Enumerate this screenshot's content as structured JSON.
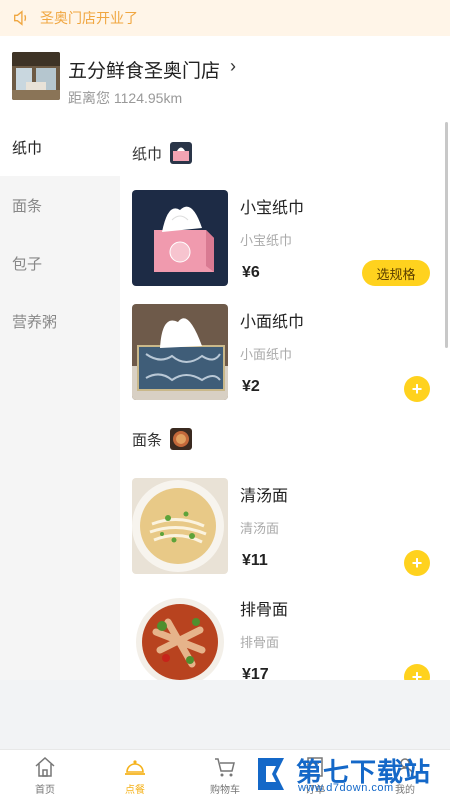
{
  "notice": {
    "text": "圣奥门店开业了",
    "icon": "speaker-icon"
  },
  "store": {
    "name": "五分鲜食圣奥门店",
    "distance": "距离您 1124.95km"
  },
  "categories": [
    "纸巾",
    "面条",
    "包子",
    "营养粥"
  ],
  "active_category": "纸巾",
  "sections": [
    {
      "title": "纸巾",
      "items": [
        {
          "name": "小宝纸巾",
          "desc": "小宝纸巾",
          "price": "¥6",
          "action": "选规格"
        },
        {
          "name": "小面纸巾",
          "desc": "小面纸巾",
          "price": "¥2",
          "action": "+"
        }
      ]
    },
    {
      "title": "面条",
      "items": [
        {
          "name": "清汤面",
          "desc": "清汤面",
          "price": "¥11",
          "action": "+"
        },
        {
          "name": "排骨面",
          "desc": "排骨面",
          "price": "¥17",
          "action": "+"
        }
      ]
    }
  ],
  "tabs": [
    {
      "label": "首页",
      "icon": "home-icon"
    },
    {
      "label": "点餐",
      "icon": "cloche-icon",
      "active": true
    },
    {
      "label": "购物车",
      "icon": "cart-icon"
    },
    {
      "label": "订单",
      "icon": "order-icon"
    },
    {
      "label": "我的",
      "icon": "user-icon"
    }
  ],
  "watermark": {
    "name": "第七下载站",
    "url": "www.d7down.com"
  },
  "colors": {
    "accent": "#ffd21e",
    "notice_text": "#f0a640",
    "active_tab": "#f5b21b",
    "watermark": "#1468c8"
  }
}
